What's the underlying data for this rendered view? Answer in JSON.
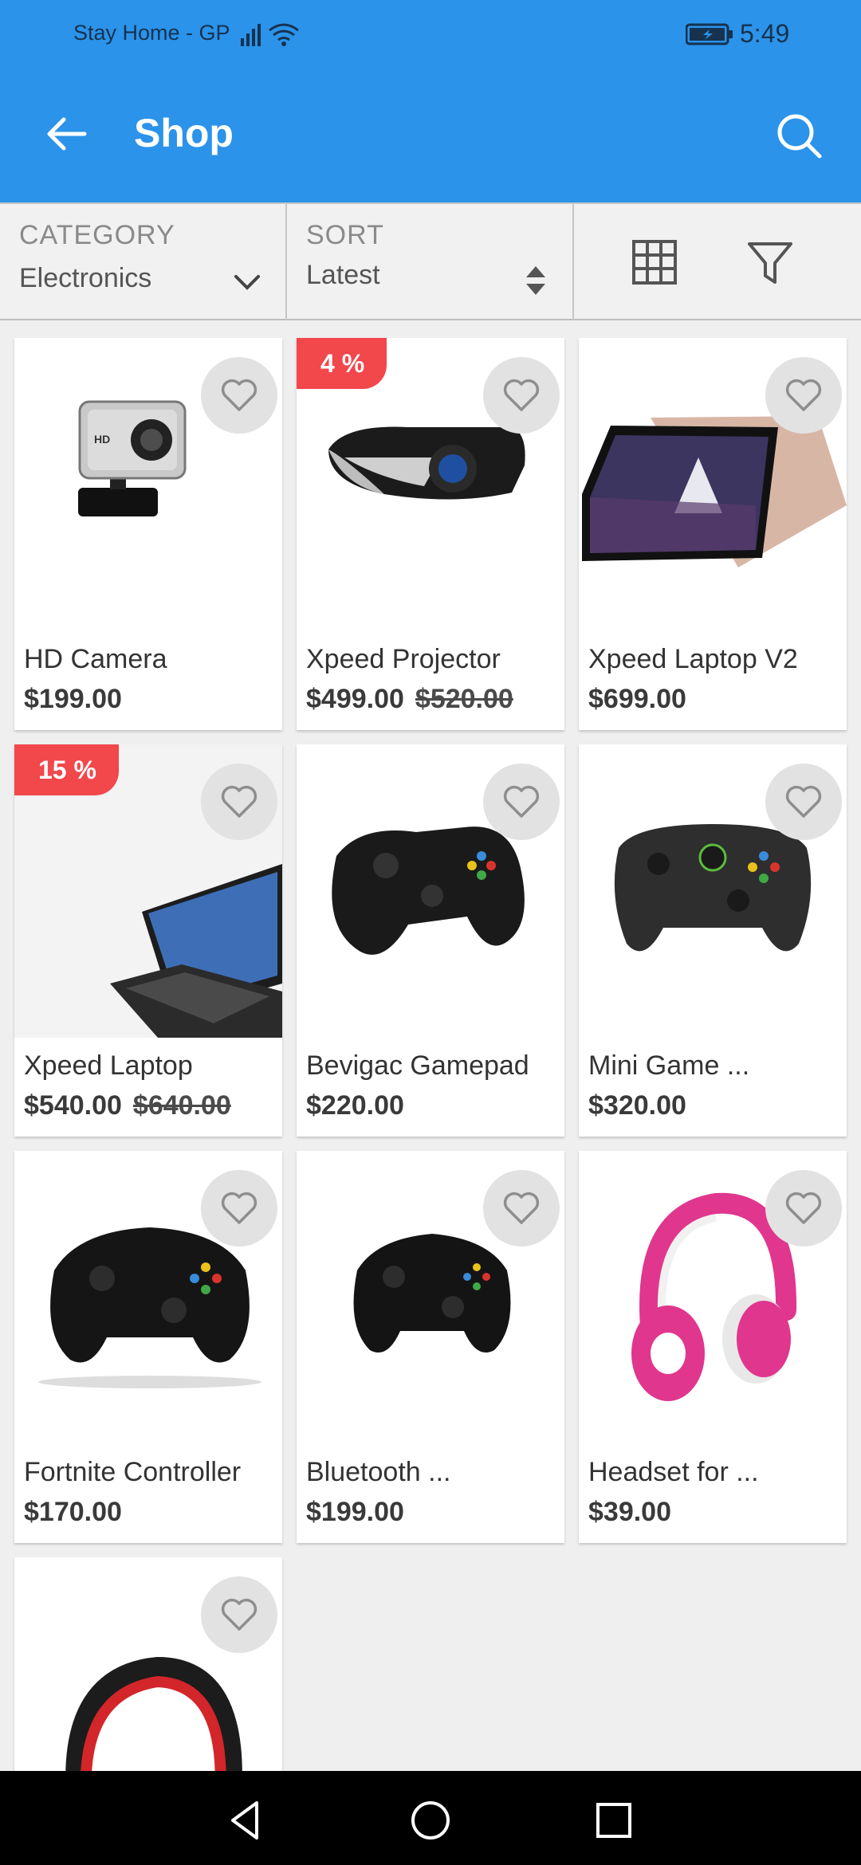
{
  "status": {
    "carrier": "Stay Home - GP",
    "time": "5:49"
  },
  "appbar": {
    "title": "Shop",
    "back_icon": "arrow-left-icon",
    "search_icon": "search-icon"
  },
  "filters": {
    "category_label": "CATEGORY",
    "category_value": "Electronics",
    "sort_label": "SORT",
    "sort_value": "Latest",
    "grid_icon": "grid-view-icon",
    "filter_icon": "filter-icon"
  },
  "products": [
    {
      "name": "HD Camera",
      "price": "$199.00",
      "old_price": "",
      "discount": ""
    },
    {
      "name": "Xpeed Projector",
      "price": "$499.00",
      "old_price": "$520.00",
      "discount": "4 %"
    },
    {
      "name": "Xpeed Laptop  V2",
      "price": "$699.00",
      "old_price": "",
      "discount": ""
    },
    {
      "name": "Xpeed Laptop",
      "price": "$540.00",
      "old_price": "$640.00",
      "discount": "15 %"
    },
    {
      "name": "Bevigac Gamepad",
      "price": "$220.00",
      "old_price": "",
      "discount": ""
    },
    {
      "name": "Mini Game ...",
      "price": "$320.00",
      "old_price": "",
      "discount": ""
    },
    {
      "name": "Fortnite Controller",
      "price": "$170.00",
      "old_price": "",
      "discount": ""
    },
    {
      "name": "Bluetooth ...",
      "price": "$199.00",
      "old_price": "",
      "discount": ""
    },
    {
      "name": "Headset for ...",
      "price": "$39.00",
      "old_price": "",
      "discount": ""
    },
    {
      "name": "",
      "price": "",
      "old_price": "",
      "discount": ""
    }
  ],
  "colors": {
    "primary": "#2b93ea",
    "discount": "#f2474b"
  }
}
